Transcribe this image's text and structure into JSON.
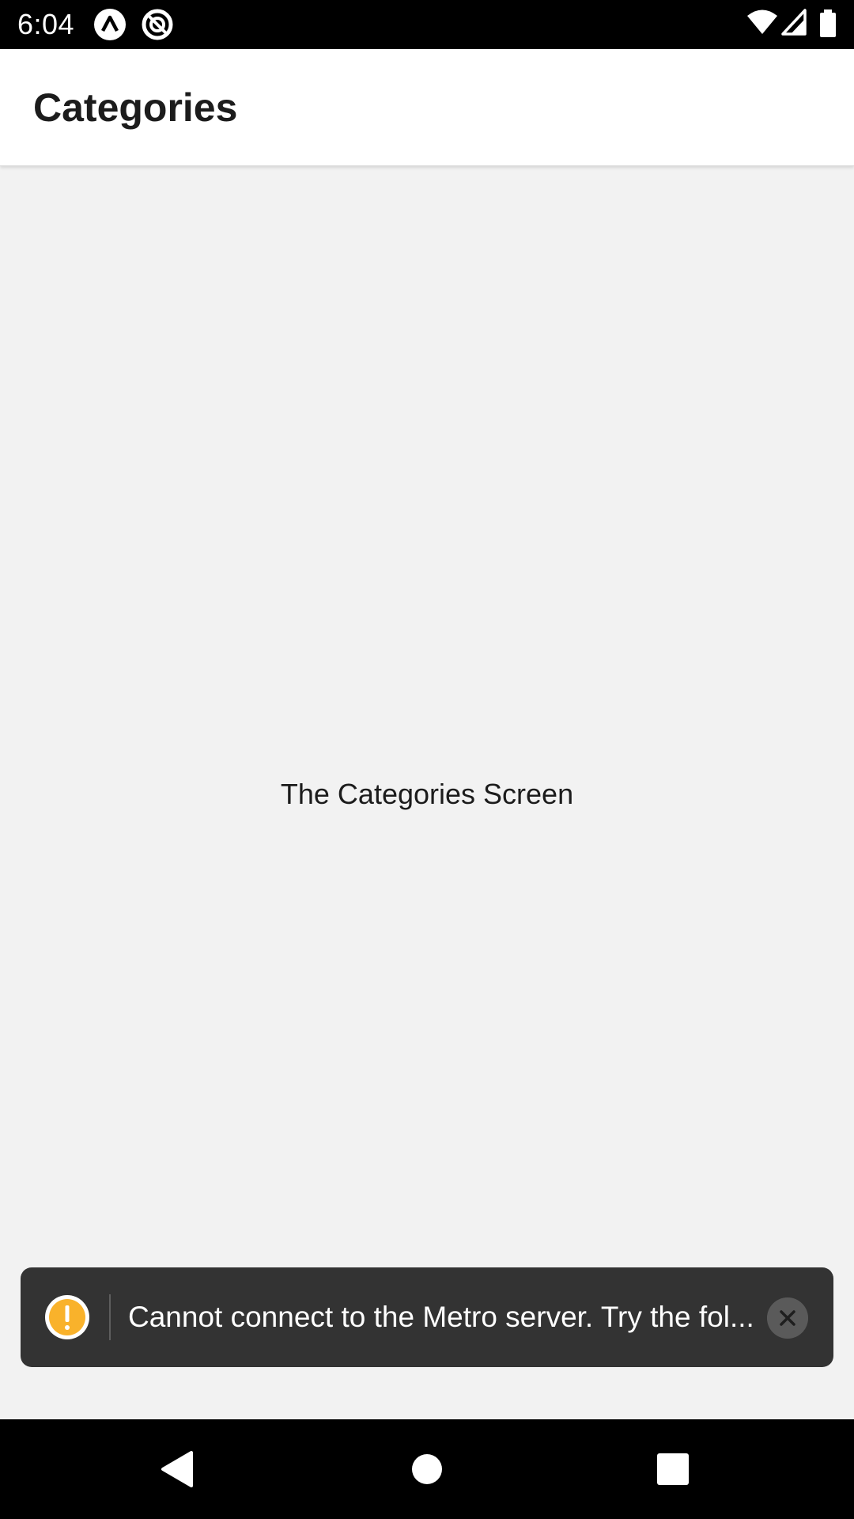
{
  "status_bar": {
    "time": "6:04",
    "icons": [
      "app-a-icon",
      "no-sync-icon",
      "wifi-icon",
      "cellular-signal-icon",
      "battery-icon"
    ]
  },
  "header": {
    "title": "Categories"
  },
  "main": {
    "label": "The Categories Screen"
  },
  "toast": {
    "message": "Cannot connect to the Metro server.  Try the fol...",
    "icon": "warning-icon",
    "accent_color": "#f9b22b"
  },
  "nav": {
    "buttons": [
      "back-icon",
      "home-icon",
      "recents-icon"
    ]
  },
  "colors": {
    "status_bar": "#000000",
    "header_bg": "#ffffff",
    "screen_bg": "#f2f2f2",
    "toast_bg": "#333333"
  }
}
